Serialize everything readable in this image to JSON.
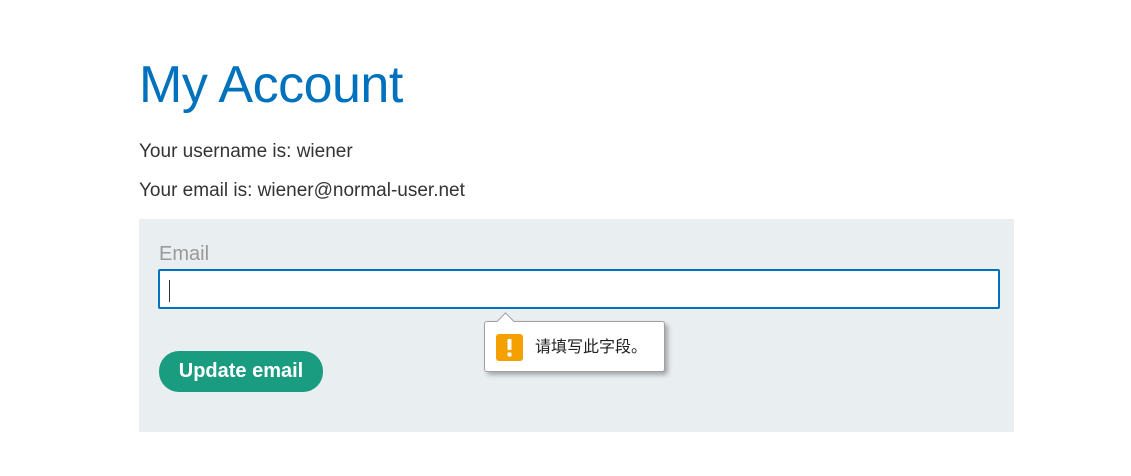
{
  "page": {
    "title": "My Account",
    "username_text": "Your username is: wiener",
    "email_text": "Your email is: wiener@normal-user.net"
  },
  "form": {
    "email_label": "Email",
    "email_value": "",
    "submit_label": "Update email"
  },
  "validation_tooltip": {
    "message": "请填写此字段。",
    "icon": "warning-icon"
  },
  "colors": {
    "title": "#0071bc",
    "input_border_focus": "#0071bc",
    "button_bg": "#1a9c80",
    "panel_bg": "#e9eef1",
    "warning_icon": "#f4a000"
  }
}
